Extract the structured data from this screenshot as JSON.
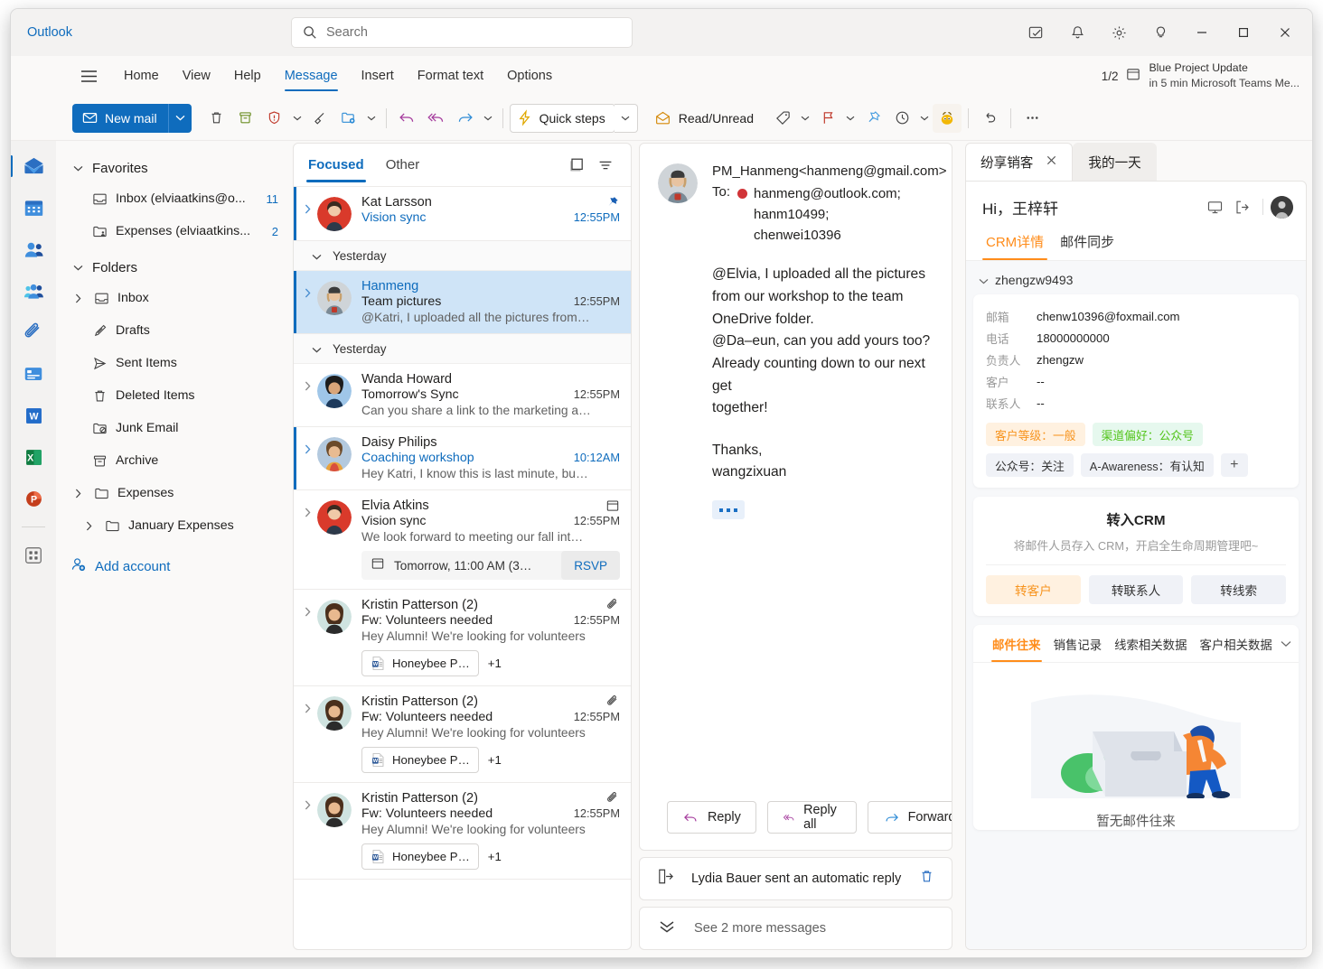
{
  "titlebar": {
    "brand": "Outlook",
    "search_placeholder": "Search",
    "buttons": [
      {
        "name": "notes-icon",
        "label": "Notes"
      },
      {
        "name": "bell-icon",
        "label": "Notifications"
      },
      {
        "name": "gear-icon",
        "label": "Settings"
      },
      {
        "name": "lightbulb-icon",
        "label": "Tips"
      },
      {
        "name": "minimize-icon",
        "label": "Minimize"
      },
      {
        "name": "maximize-icon",
        "label": "Maximize"
      },
      {
        "name": "close-icon",
        "label": "Close"
      }
    ]
  },
  "ribbon": {
    "tabs": [
      {
        "label": "Home",
        "active": false
      },
      {
        "label": "View",
        "active": false
      },
      {
        "label": "Help",
        "active": false
      },
      {
        "label": "Message",
        "active": true
      },
      {
        "label": "Insert",
        "active": false
      },
      {
        "label": "Format text",
        "active": false
      },
      {
        "label": "Options",
        "active": false
      }
    ],
    "upnext": {
      "pagecount": "1/2",
      "line1": "Blue Project Update",
      "line2": "in 5 min Microsoft Teams Me..."
    }
  },
  "commandbar": {
    "new_mail": "New mail",
    "quick_steps": "Quick steps",
    "read_unread": "Read/Unread",
    "icons": [
      "delete-icon",
      "archive-icon",
      "report-icon",
      "sweep-icon",
      "move-to-icon",
      "reply-icon",
      "reply-all-icon",
      "forward-icon",
      "tag-icon",
      "flag-icon",
      "pin-icon",
      "snooze-icon",
      "copilot-icon",
      "undo-icon",
      "more-options-icon"
    ]
  },
  "rail": {
    "items": [
      {
        "name": "mail-icon",
        "label": "Mail",
        "selected": true
      },
      {
        "name": "calendar-icon",
        "label": "Calendar",
        "selected": false
      },
      {
        "name": "people-icon",
        "label": "People",
        "selected": false
      },
      {
        "name": "groups-icon",
        "label": "Groups",
        "selected": false
      },
      {
        "name": "attachments-icon",
        "label": "Files",
        "selected": false
      },
      {
        "name": "bookings-icon",
        "label": "Bookings",
        "selected": false
      },
      {
        "name": "word-icon",
        "label": "Word",
        "selected": false
      },
      {
        "name": "excel-icon",
        "label": "Excel",
        "selected": false
      },
      {
        "name": "powerpoint-icon",
        "label": "PowerPoint",
        "selected": false
      },
      {
        "name": "apps-icon",
        "label": "More apps",
        "selected": false
      }
    ]
  },
  "folders": {
    "favorites_label": "Favorites",
    "favorites": [
      {
        "label": "Inbox (elviaatkins@o...",
        "count": "11",
        "icon": "inbox-icon"
      },
      {
        "label": "Expenses (elviaatkins...",
        "count": "2",
        "icon": "shared-folder-icon"
      }
    ],
    "folders_label": "Folders",
    "items": [
      {
        "label": "Inbox",
        "icon": "inbox-icon",
        "chevron": true,
        "indent": 0
      },
      {
        "label": "Drafts",
        "icon": "drafts-icon",
        "chevron": false,
        "indent": 0
      },
      {
        "label": "Sent Items",
        "icon": "sent-icon",
        "chevron": false,
        "indent": 0
      },
      {
        "label": "Deleted Items",
        "icon": "trash-icon",
        "chevron": false,
        "indent": 0
      },
      {
        "label": "Junk Email",
        "icon": "junk-icon",
        "chevron": false,
        "indent": 0
      },
      {
        "label": "Archive",
        "icon": "archive-icon",
        "chevron": false,
        "indent": 0
      },
      {
        "label": "Expenses",
        "icon": "folder-icon",
        "chevron": true,
        "indent": 0
      },
      {
        "label": "January Expenses",
        "icon": "folder-icon",
        "chevron": true,
        "indent": 1
      }
    ],
    "add_account": "Add account"
  },
  "msglist": {
    "tabs": [
      {
        "label": "Focused",
        "active": true
      },
      {
        "label": "Other",
        "active": false
      }
    ],
    "header_icons": [
      "reading-pane-icon",
      "filter-icon"
    ],
    "items": [
      {
        "type": "msg",
        "sender": "Kat Larsson",
        "subject": "Vision sync",
        "preview": "",
        "time": "12:55PM",
        "unread": true,
        "selected": false,
        "subject_hl": true,
        "time_hl": true,
        "right_icon": "pin-icon",
        "avatar": "kat"
      },
      {
        "type": "day",
        "label": "Yesterday"
      },
      {
        "type": "msg",
        "sender": "Hanmeng",
        "subject": "Team pictures",
        "preview": "@Katri, I uploaded all the pictures from…",
        "time": "12:55PM",
        "unread": true,
        "selected": true,
        "sender_hl": true,
        "avatar": "hanmeng"
      },
      {
        "type": "day",
        "label": "Yesterday"
      },
      {
        "type": "msg",
        "sender": "Wanda Howard",
        "subject": "Tomorrow's Sync",
        "preview": "Can you share a link to the marketing a…",
        "time": "12:55PM",
        "unread": false,
        "selected": false,
        "avatar": "wanda"
      },
      {
        "type": "msg",
        "sender": "Daisy Philips",
        "subject": "Coaching workshop",
        "preview": "Hey Katri, I know this is last minute, bu…",
        "time": "10:12AM",
        "unread": true,
        "selected": false,
        "subject_hl": true,
        "time_hl": true,
        "avatar": "daisy"
      },
      {
        "type": "msg",
        "sender": "Elvia Atkins",
        "subject": "Vision sync",
        "preview": "We look forward to meeting our fall int…",
        "time": "12:55PM",
        "unread": false,
        "selected": false,
        "right_icon": "calendar-icon",
        "avatar": "elvia",
        "event": {
          "text": "Tomorrow, 11:00 AM (3…",
          "button": "RSVP"
        }
      },
      {
        "type": "msg",
        "sender": "Kristin Patterson (2)",
        "subject": "Fw: Volunteers needed",
        "preview": "Hey Alumni! We're looking for volunteers",
        "time": "12:55PM",
        "unread": false,
        "selected": false,
        "right_icon": "attachment-icon",
        "avatar": "kristin",
        "attachment": {
          "name": "Honeybee P…",
          "plus": "+1"
        }
      },
      {
        "type": "msg",
        "sender": "Kristin Patterson (2)",
        "subject": "Fw: Volunteers needed",
        "preview": "Hey Alumni! We're looking for volunteers",
        "time": "12:55PM",
        "unread": false,
        "selected": false,
        "right_icon": "attachment-icon",
        "avatar": "kristin",
        "attachment": {
          "name": "Honeybee P…",
          "plus": "+1"
        }
      },
      {
        "type": "msg",
        "sender": "Kristin Patterson (2)",
        "subject": "Fw: Volunteers needed",
        "preview": "Hey Alumni! We're looking for volunteers",
        "time": "12:55PM",
        "unread": false,
        "selected": false,
        "right_icon": "attachment-icon",
        "avatar": "kristin",
        "attachment": {
          "name": "Honeybee P…",
          "plus": "+1"
        }
      }
    ]
  },
  "reading": {
    "from": "PM_Hanmeng<hanmeng@gmail.com>",
    "to_label": "To:",
    "recipients": [
      "hanmeng@outlook.com;",
      "hanm10499;",
      "chenwei10396"
    ],
    "body_lines": [
      "@Elvia, I uploaded all the pictures",
      "from our workshop to the team",
      "OneDrive folder.",
      "@Da–eun, can you add yours too?",
      "Already counting down to our next get",
      "together!",
      "",
      "Thanks,",
      "wangzixuan"
    ],
    "actions": [
      {
        "label": "Reply",
        "icon": "reply-icon"
      },
      {
        "label": "Reply all",
        "icon": "reply-all-icon"
      },
      {
        "label": "Forward",
        "icon": "forward-icon"
      }
    ],
    "auto_reply": "Lydia Bauer sent an automatic reply",
    "see_more": "See 2 more messages"
  },
  "crm": {
    "tabs": [
      {
        "label": "纷享销客",
        "active": true,
        "closable": true
      },
      {
        "label": "我的一天",
        "active": false,
        "closable": false
      }
    ],
    "greeting": "Hi，王梓轩",
    "subtabs": [
      {
        "label": "CRM详情",
        "active": true
      },
      {
        "label": "邮件同步",
        "active": false
      }
    ],
    "account": "zhengzw9493",
    "fields": [
      {
        "key": "邮箱",
        "value": "chenw10396@foxmail.com"
      },
      {
        "key": "电话",
        "value": "18000000000"
      },
      {
        "key": "负责人",
        "value": "zhengzw"
      },
      {
        "key": "客户",
        "value": "--"
      },
      {
        "key": "联系人",
        "value": "--"
      }
    ],
    "tags": [
      {
        "label": "客户等级：一般",
        "style": "orange"
      },
      {
        "label": "渠道偏好：公众号",
        "style": "green"
      },
      {
        "label": "公众号：关注",
        "style": "grey"
      },
      {
        "label": "A-Awareness：有认知",
        "style": "grey"
      },
      {
        "label": "+",
        "style": "plus"
      }
    ],
    "convert": {
      "title": "转入CRM",
      "subtitle": "将邮件人员存入 CRM，开启全生命周期管理吧~",
      "buttons": [
        {
          "label": "转客户",
          "style": "primary"
        },
        {
          "label": "转联系人",
          "style": "normal"
        },
        {
          "label": "转线索",
          "style": "normal"
        }
      ]
    },
    "bottom_tabs": [
      {
        "label": "邮件往来",
        "active": true
      },
      {
        "label": "销售记录",
        "active": false
      },
      {
        "label": "线索相关数据",
        "active": false
      },
      {
        "label": "客户相关数据",
        "active": false
      }
    ],
    "empty_text": "暂无邮件往来"
  },
  "colors": {
    "accent": "#0f6cbd",
    "crm_accent": "#ff8c1a",
    "selected_row": "#cfe4f7"
  }
}
